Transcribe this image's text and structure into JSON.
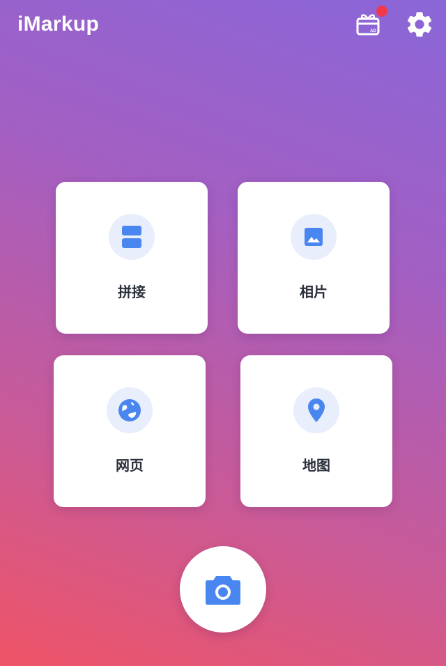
{
  "header": {
    "title": "iMarkup",
    "gift_icon": "gift-ad-icon",
    "gift_badge_color": "#f2394b",
    "settings_icon": "gear-icon"
  },
  "cards": [
    {
      "label": "拼接",
      "icon": "stitch-icon"
    },
    {
      "label": "相片",
      "icon": "image-icon"
    },
    {
      "label": "网页",
      "icon": "globe-icon"
    },
    {
      "label": "地图",
      "icon": "map-pin-icon"
    }
  ],
  "camera_button": {
    "icon": "camera-icon"
  },
  "colors": {
    "accent": "#4a86f0",
    "icon_circle_bg": "#e8eefb",
    "gradient_top": "#8a66d8",
    "gradient_bottom": "#ef5467"
  }
}
